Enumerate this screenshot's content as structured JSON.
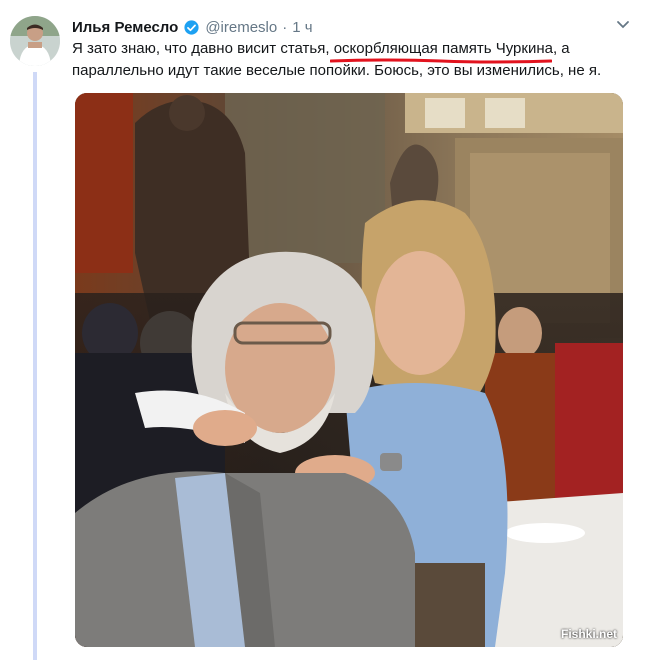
{
  "tweet": {
    "author_name": "Илья Ремесло",
    "handle": "@iremeslo",
    "separator": "·",
    "time": "1 ч",
    "text_before": "Я зато знаю, что давно висит статья, ",
    "text_highlight": "оскорбляющая память Чуркина",
    "text_after": ", а параллельно идут такие веселые попойки. Боюсь, это вы изменились, не я.",
    "menu_icon": "chevron-down-icon",
    "verified_icon": "verified-badge-icon"
  },
  "watermark": "Fishki.net",
  "colors": {
    "underline": "#e2131e",
    "verified": "#1da1f2",
    "thread_line": "#cfd9f7"
  }
}
